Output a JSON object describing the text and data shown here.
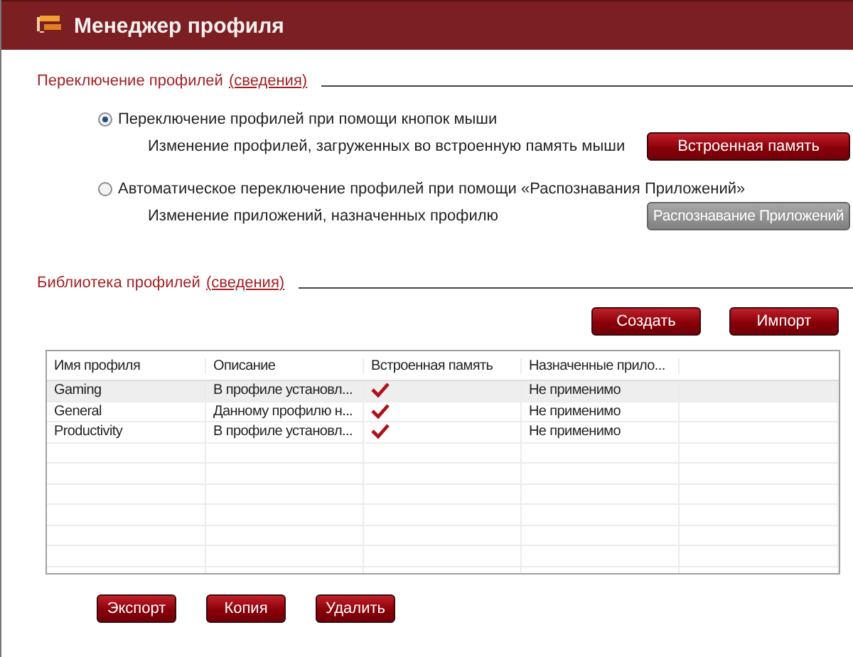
{
  "window": {
    "title": "Менеджер профиля"
  },
  "switching": {
    "heading": "Переключение профилей",
    "link": "(сведения)",
    "options": [
      {
        "label": "Переключение профилей при помощи кнопок мыши",
        "selected": true,
        "description": "Изменение профилей, загруженных во встроенную память мыши",
        "button": {
          "label": "Встроенная память",
          "disabled": false
        }
      },
      {
        "label": "Автоматическое переключение профилей при помощи «Распознавания Приложений»",
        "selected": false,
        "description": "Изменение приложений, назначенных профилю",
        "button": {
          "label": "Распознавание Приложений",
          "disabled": true
        }
      }
    ]
  },
  "library": {
    "heading": "Библиотека профилей",
    "link": "(сведения)",
    "top_buttons": [
      "Создать",
      "Импорт"
    ],
    "table": {
      "columns": [
        "Имя профиля",
        "Описание",
        "Встроенная память",
        "Назначенные прило..."
      ],
      "rows": [
        {
          "name": "Gaming",
          "description": "В профиле установл...",
          "in_memory": true,
          "apps": "Не применимо",
          "selected": true
        },
        {
          "name": "General",
          "description": "Данному профилю н...",
          "in_memory": true,
          "apps": "Не применимо",
          "selected": false
        },
        {
          "name": "Productivity",
          "description": "В профиле установл...",
          "in_memory": true,
          "apps": "Не применимо",
          "selected": false
        }
      ]
    },
    "bottom_buttons": [
      "Экспорт",
      "Копия",
      "Удалить"
    ]
  }
}
